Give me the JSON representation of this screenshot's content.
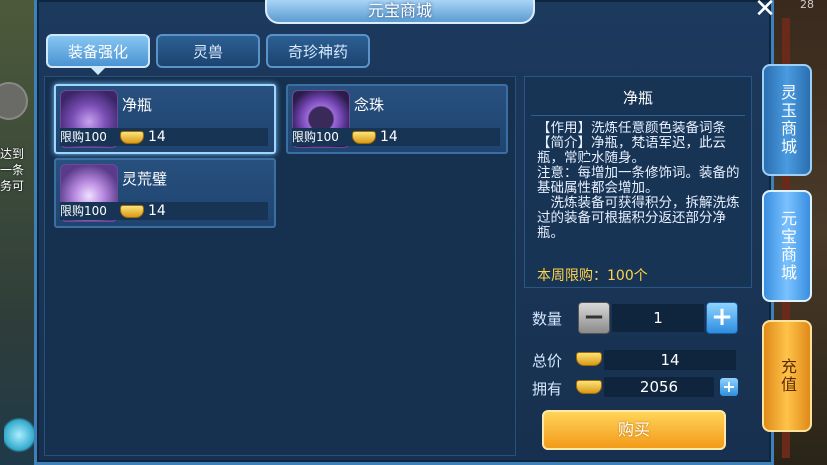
{
  "window": {
    "title": "元宝商城",
    "close_label": "✕",
    "corner_text": "28"
  },
  "background": {
    "left_text": "达到\n一条\n务可"
  },
  "tabs": [
    {
      "label": "装备强化",
      "active": true
    },
    {
      "label": "灵兽",
      "active": false
    },
    {
      "label": "奇珍神药",
      "active": false
    }
  ],
  "items": [
    {
      "name": "净瓶",
      "limit": "限购100",
      "price": "14",
      "icon": "vase-icon",
      "selected": true
    },
    {
      "name": "念珠",
      "limit": "限购100",
      "price": "14",
      "icon": "prayer-beads-icon",
      "selected": false
    },
    {
      "name": "灵荒璧",
      "limit": "限购100",
      "price": "14",
      "icon": "jade-disc-icon",
      "selected": false
    }
  ],
  "details": {
    "title": "净瓶",
    "lines": [
      "【作用】洗炼任意颜色装备词条",
      "【简介】净瓶，梵语军迟，此云瓶，常贮水随身。",
      "注意：每增加一条修饰词。装备的基础属性都会增加。",
      "　洗炼装备可获得积分，拆解洗炼过的装备可根据积分返还部分净瓶。"
    ],
    "weekly_limit": "本周限购：100个"
  },
  "purchase": {
    "quantity_label": "数量",
    "quantity": "1",
    "minus_label": "−",
    "plus_label": "+",
    "total_label": "总价",
    "total": "14",
    "owned_label": "拥有",
    "owned": "2056",
    "buy_label": "购买"
  },
  "side_tabs": [
    {
      "label": "灵玉商城",
      "style": "blue"
    },
    {
      "label": "元宝商城",
      "style": "active"
    },
    {
      "label": "充值",
      "style": "orange"
    }
  ],
  "colors": {
    "accent": "#4b93d2",
    "gold": "#ffd34a",
    "buy_button": "#f39a1a",
    "panel": "#16304f"
  }
}
